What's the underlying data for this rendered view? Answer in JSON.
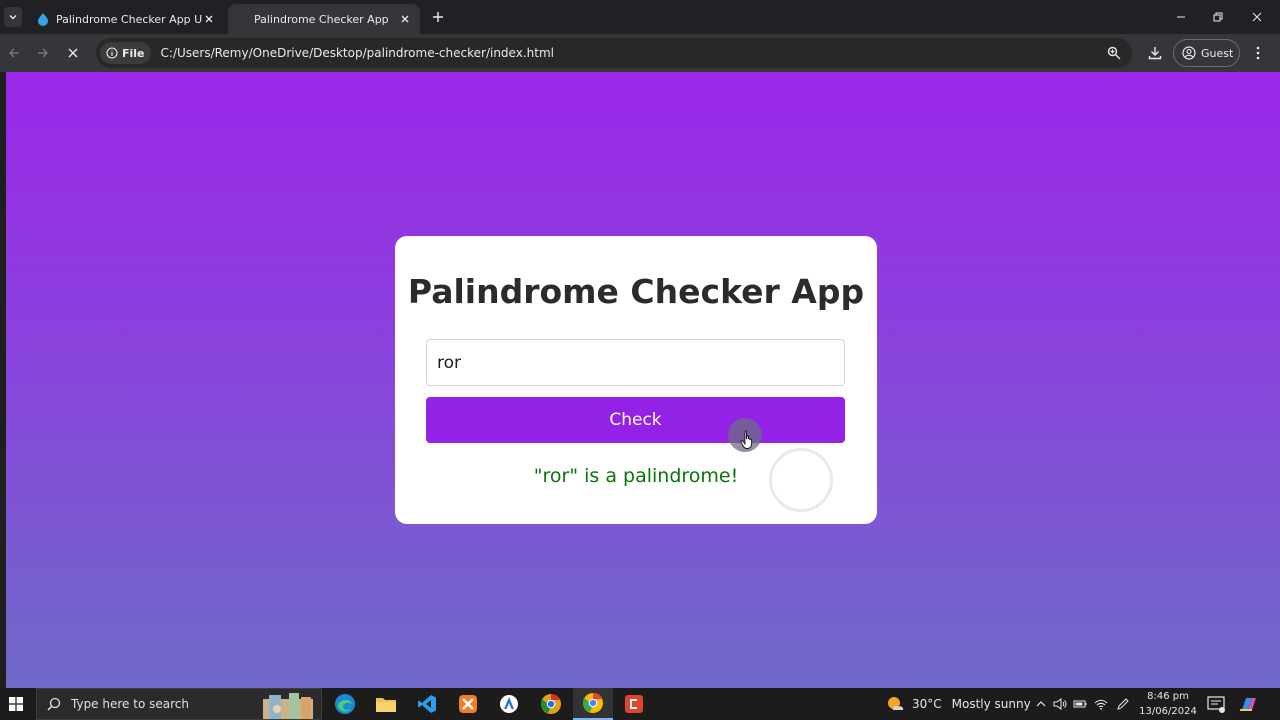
{
  "browser": {
    "tabs": [
      {
        "title": "Palindrome Checker App Using",
        "active": false
      },
      {
        "title": "Palindrome Checker App",
        "active": true
      }
    ],
    "address": {
      "chip_label": "File",
      "url": "C:/Users/Remy/OneDrive/Desktop/palindrome-checker/index.html"
    },
    "profile_label": "Guest"
  },
  "app": {
    "title": "Palindrome Checker App",
    "input_value": "ror",
    "button_label": "Check",
    "result": "\"ror\" is a palindrome!"
  },
  "taskbar": {
    "search_placeholder": "Type here to search",
    "apps": [
      "edge-icon",
      "file-explorer-icon",
      "vscode-icon",
      "xampp-icon",
      "app-icon",
      "chrome-canary-icon",
      "chrome-icon",
      "terminal-red-icon"
    ],
    "weather": {
      "temp": "30°C",
      "desc": "Mostly sunny"
    },
    "clock": {
      "time": "8:46 pm",
      "date": "13/06/2024"
    }
  },
  "colors": {
    "accent": "#9421e6",
    "success": "#087508",
    "bg_top": "#9b27e8",
    "bg_bottom": "#6f6ac8"
  }
}
